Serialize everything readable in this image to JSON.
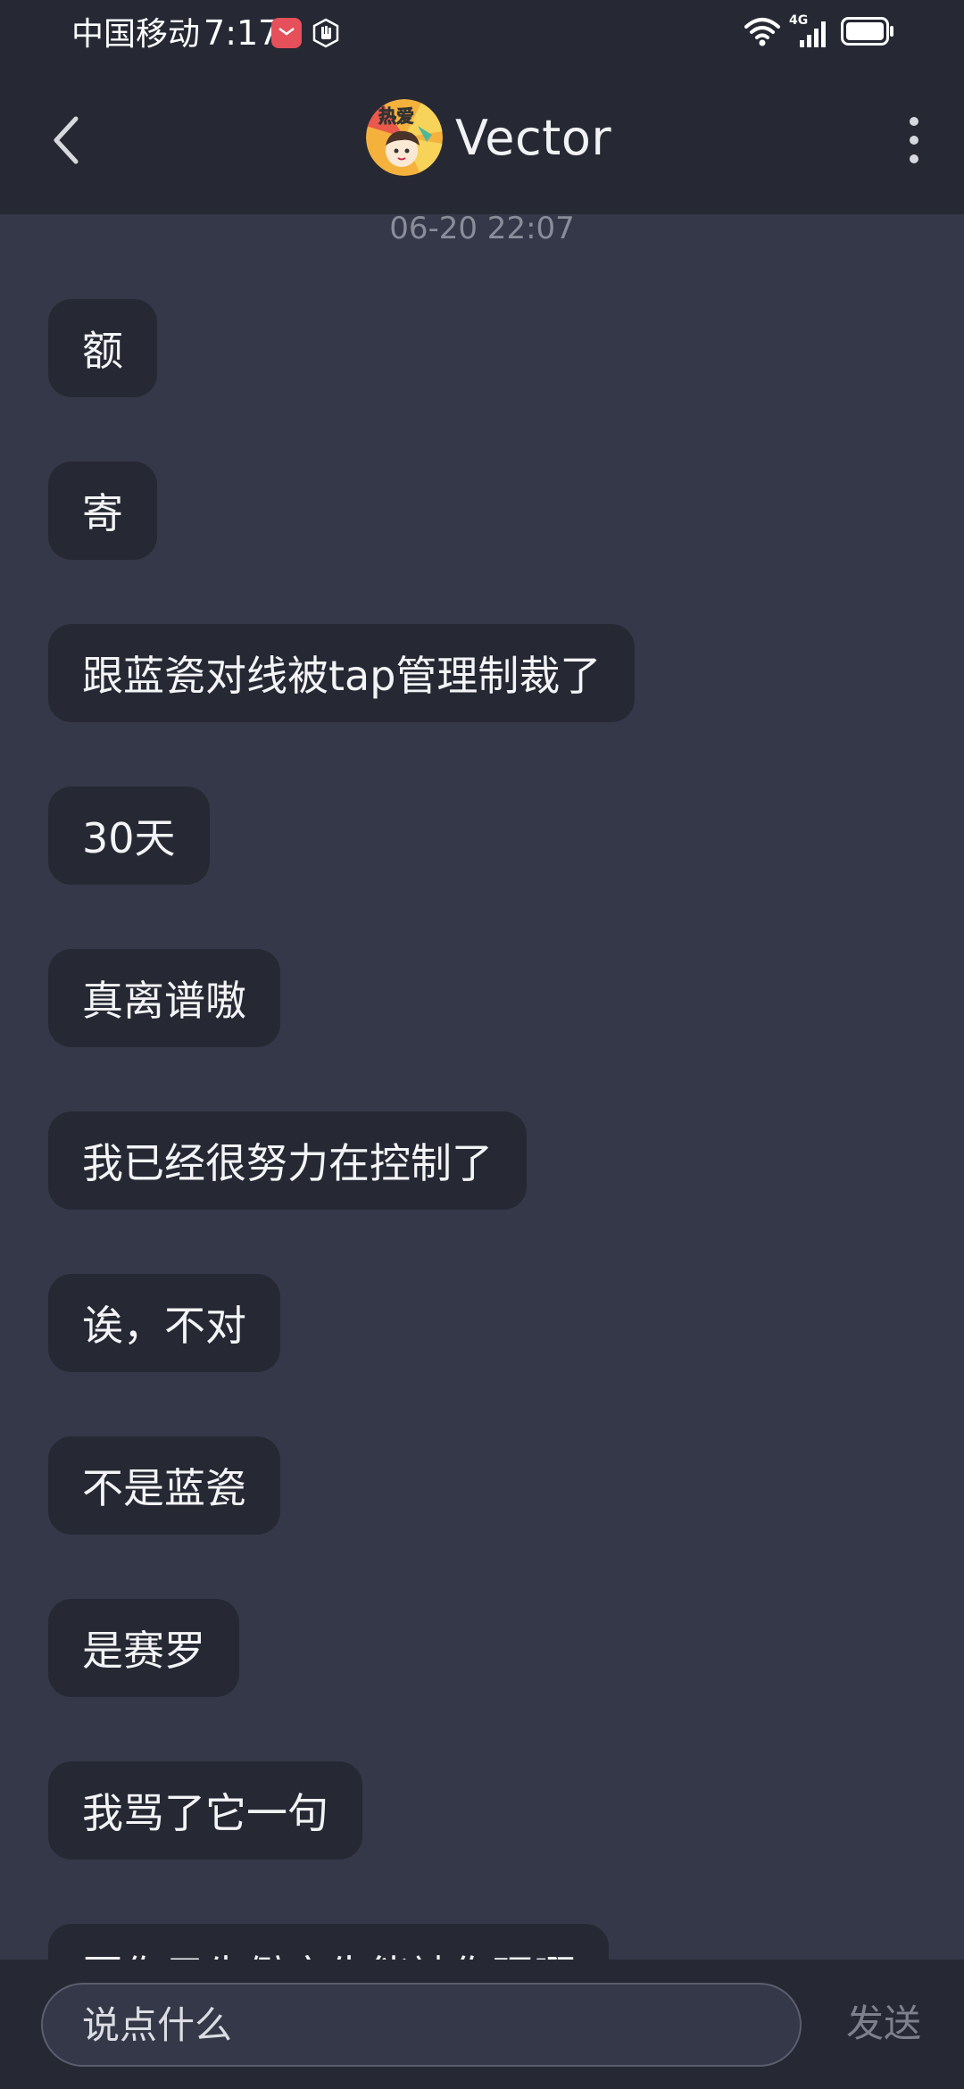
{
  "status_bar": {
    "carrier": "中国移动",
    "time": "7:17",
    "network": "4G"
  },
  "header": {
    "contact_name": "Vector",
    "avatar_text": "热爱"
  },
  "chat": {
    "timestamp": "06-20 22:07",
    "messages": [
      "额",
      "寄",
      "跟蓝瓷对线被tap管理制裁了",
      "30天",
      "真离谱嗷",
      "我已经很努力在控制了",
      "诶，不对",
      "不是蓝瓷",
      "是赛罗",
      "我骂了它一句",
      "因你只先僻夜生能被你理啊"
    ]
  },
  "composer": {
    "placeholder": "说点什么",
    "send_label": "发送"
  }
}
